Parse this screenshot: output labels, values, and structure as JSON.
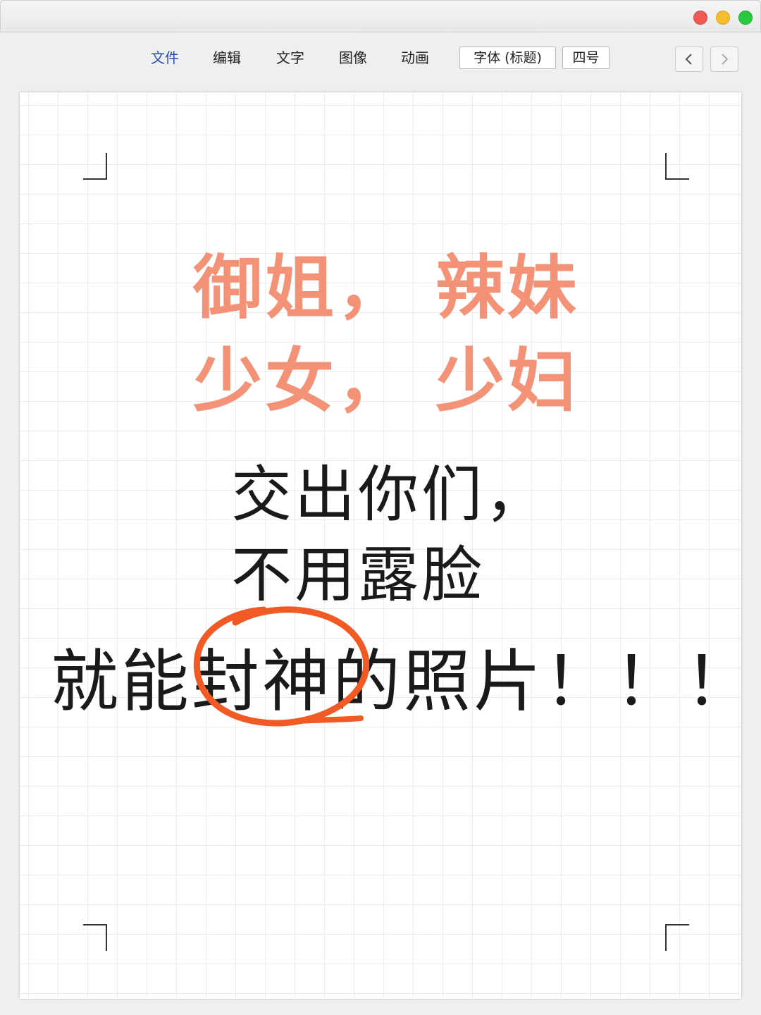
{
  "window": {
    "traffic_lights": {
      "close": "#ee5a52",
      "minimize": "#f5bd2f",
      "zoom": "#27c93f"
    }
  },
  "toolbar": {
    "menus": [
      {
        "label": "文件",
        "active": true
      },
      {
        "label": "编辑",
        "active": false
      },
      {
        "label": "文字",
        "active": false
      },
      {
        "label": "图像",
        "active": false
      },
      {
        "label": "动画",
        "active": false
      }
    ],
    "font_family_value": "字体 (标题)",
    "font_size_value": "四号",
    "nav": {
      "back_icon": "chevron-left-icon",
      "forward_icon": "chevron-right-icon"
    }
  },
  "document": {
    "line1": "御姐，  辣妹",
    "line2": "少女，  少妇",
    "line3": "交出你们，",
    "line4": "不用露脸",
    "line5": "就能封神的照片！！！",
    "highlight_circle_text": "封神",
    "colors": {
      "accent_text": "#f39277",
      "circle": "#f15a24",
      "body_text": "#1a1a1a"
    }
  }
}
